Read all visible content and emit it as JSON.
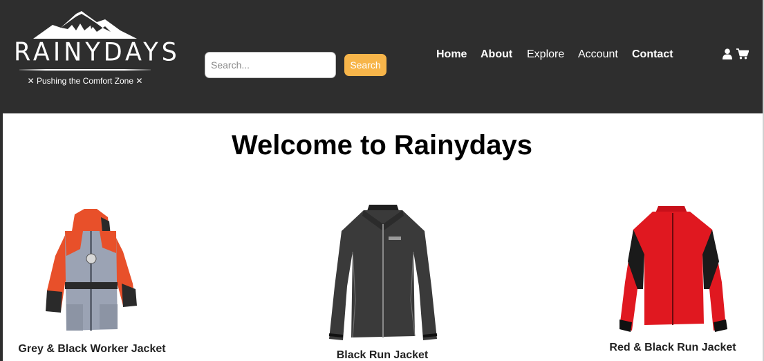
{
  "header": {
    "logo": {
      "brand": "RAINYDAYS",
      "tagline": "✕ Pushing the Comfort Zone ✕"
    },
    "search": {
      "placeholder": "Search...",
      "value": "",
      "button_label": "Search"
    },
    "nav": [
      {
        "label": "Home",
        "bold": true
      },
      {
        "label": "About",
        "bold": true
      },
      {
        "label": "Explore",
        "bold": false
      },
      {
        "label": "Account",
        "bold": false
      },
      {
        "label": "Contact",
        "bold": true
      }
    ],
    "icons": [
      "user-icon",
      "cart-icon"
    ]
  },
  "main": {
    "heading": "Welcome to Rainydays",
    "products": [
      {
        "name": "Grey & Black Worker Jacket"
      },
      {
        "name": "Black Run Jacket"
      },
      {
        "name": "Red & Black Run Jacket"
      }
    ]
  },
  "colors": {
    "header_bg": "#2e2e2e",
    "search_button": "#f7b54a",
    "text_dark": "#222222"
  }
}
